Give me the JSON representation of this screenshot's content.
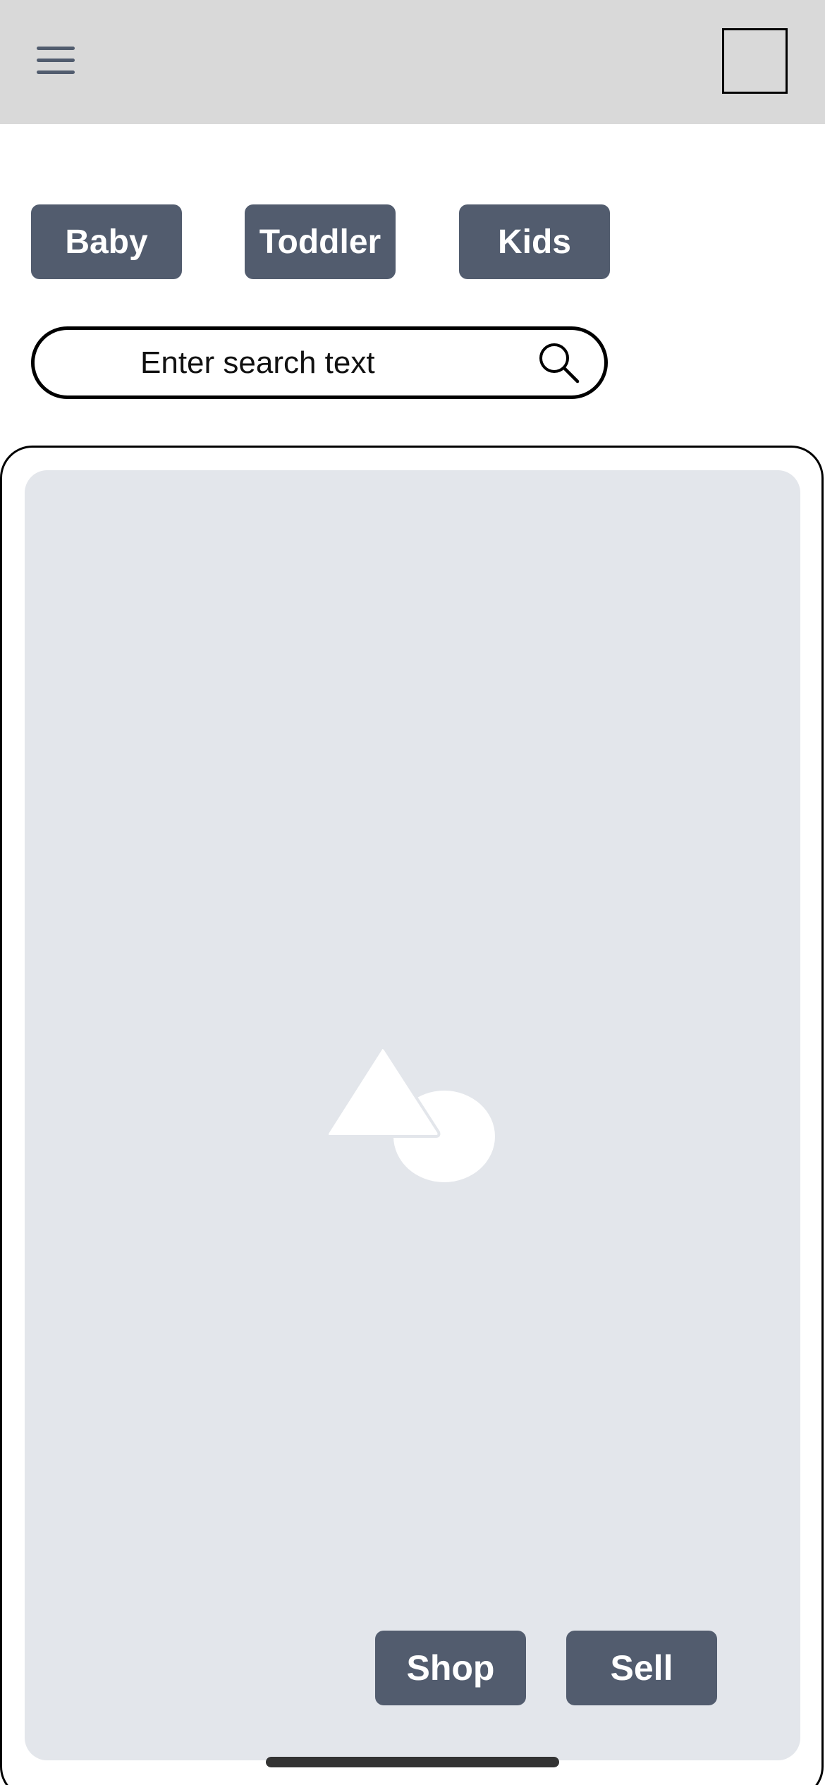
{
  "header": {
    "menu_icon": "hamburger-menu-icon",
    "profile_placeholder": "square-outline",
    "background_color": "#d9d9d9"
  },
  "categories": [
    {
      "label": "Baby"
    },
    {
      "label": "Toddler"
    },
    {
      "label": "Kids"
    }
  ],
  "search": {
    "placeholder": "Enter search text",
    "icon": "search-icon"
  },
  "hero": {
    "image_placeholder_icon": "image-placeholder-icon",
    "background_color": "#e3e6eb",
    "actions": {
      "shop_label": "Shop",
      "sell_label": "Sell"
    }
  },
  "colors": {
    "button": "#525c6e",
    "button_text": "#ffffff"
  }
}
